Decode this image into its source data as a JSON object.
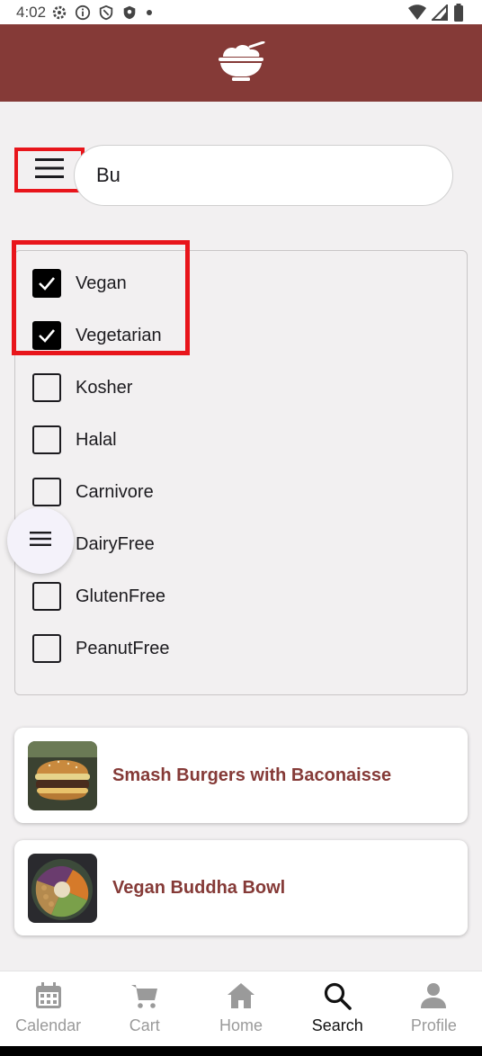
{
  "status_bar": {
    "time": "4:02",
    "icons": [
      "settings-gear-icon",
      "info-icon",
      "shield-icon",
      "shield-badge-icon",
      "dot-icon",
      "wifi-icon",
      "signal-icon",
      "battery-icon"
    ]
  },
  "header": {
    "logo_icon": "rice-bowl-icon",
    "color": "#853a37"
  },
  "search": {
    "value": "Bu",
    "menu_icon": "hamburger-menu-icon"
  },
  "filters": [
    {
      "label": "Vegan",
      "checked": true
    },
    {
      "label": "Vegetarian",
      "checked": true
    },
    {
      "label": "Kosher",
      "checked": false
    },
    {
      "label": "Halal",
      "checked": false
    },
    {
      "label": "Carnivore",
      "checked": false
    },
    {
      "label": "DairyFree",
      "checked": false
    },
    {
      "label": "GlutenFree",
      "checked": false
    },
    {
      "label": "PeanutFree",
      "checked": false
    }
  ],
  "fab": {
    "icon": "menu-icon"
  },
  "results": [
    {
      "title": "Smash Burgers with Baconaisse",
      "image": "burger-photo"
    },
    {
      "title": "Vegan Buddha Bowl",
      "image": "buddha-bowl-photo"
    }
  ],
  "bottom_nav": [
    {
      "label": "Calendar",
      "icon": "calendar-icon",
      "active": false
    },
    {
      "label": "Cart",
      "icon": "cart-icon",
      "active": false
    },
    {
      "label": "Home",
      "icon": "home-icon",
      "active": false
    },
    {
      "label": "Search",
      "icon": "search-icon",
      "active": true
    },
    {
      "label": "Profile",
      "icon": "profile-icon",
      "active": false
    }
  ],
  "colors": {
    "accent": "#853a37",
    "highlight": "#e8151b",
    "background": "#f2f0f1"
  }
}
